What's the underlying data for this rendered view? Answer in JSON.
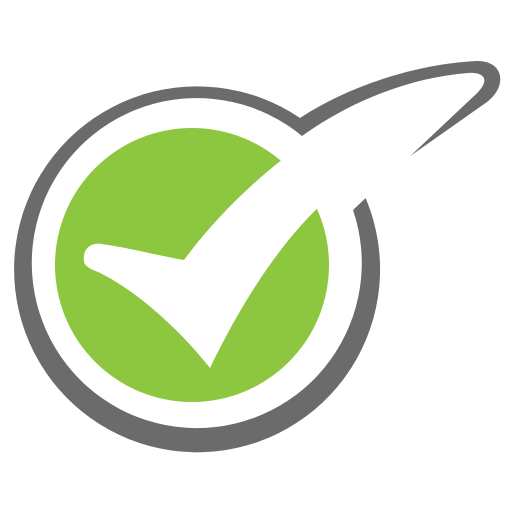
{
  "icon": {
    "name": "checkmark-badge-icon",
    "colors": {
      "outline": "#6b6b6b",
      "fill": "#8dc63f",
      "mark": "#ffffff",
      "background": "#ffffff"
    }
  }
}
